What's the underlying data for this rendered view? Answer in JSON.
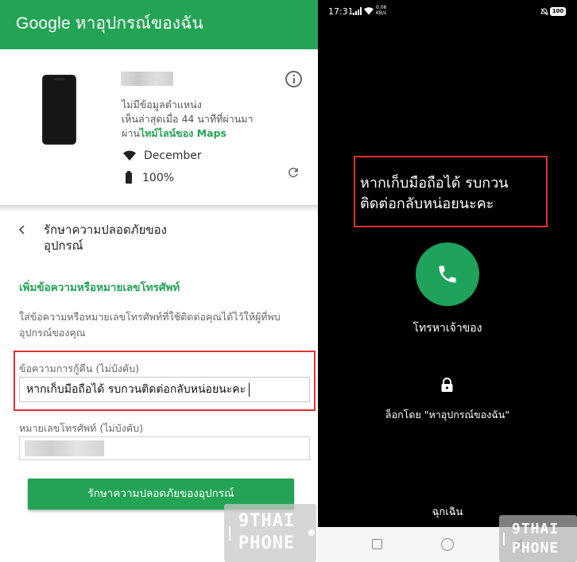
{
  "left": {
    "header": {
      "brand": "Google",
      "title": "หาอุปกรณ์ของฉัน"
    },
    "device": {
      "status_line1": "ไม่มีข้อมูลตำแหน่ง",
      "status_line2": "เห็นล่าสุดเมื่อ 44 นาทีที่ผ่านมา",
      "status_line3_prefix": "ผ่าน",
      "maps_link": "ไทม์ไลน์ของ Maps",
      "wifi": "December",
      "battery": "100%"
    },
    "secure": {
      "title": "รักษาความปลอดภัยของอุปกรณ์",
      "add_heading": "เพิ่มข้อความหรือหมายเลขโทรศัพท์",
      "description": "ใส่ข้อความหรือหมายเลขโทรศัพท์ที่ใช้ติดต่อคุณได้ไว้ให้ผู้ที่พบอุปกรณ์ของคุณ",
      "message_label": "ข้อความการกู้คืน (ไม่บังคับ)",
      "message_value": "หากเก็บมือถือได้ รบกวนติดต่อกลับหน่อยนะคะ",
      "phone_label": "หมายเลขโทรศัพท์ (ไม่บังคับ)",
      "button": "รักษาความปลอดภัยของอุปกรณ์"
    },
    "watermark": {
      "line1": "9THAI",
      "line2": "PHONE"
    }
  },
  "right": {
    "statusbar": {
      "time": "17:31",
      "speed_top": "0.06",
      "speed_bottom": "KB/s",
      "battery": "100"
    },
    "lock_message": "หากเก็บมือถือได้ รบกวน ติดต่อกลับหน่อยนะคะ",
    "call_label": "โทรหาเจ้าของ",
    "locked_by": "ล็อกโดย \"หาอุปกรณ์ของฉัน\"",
    "emergency": "ฉุกเฉิน",
    "watermark": {
      "line1": "9THAI",
      "line2": "PHONE"
    }
  },
  "icons": {
    "info": "info-icon",
    "refresh": "refresh-icon",
    "wifi": "wifi-icon",
    "battery": "battery-icon",
    "back": "chevron-left-icon",
    "call": "phone-icon",
    "lock": "lock-icon"
  },
  "colors": {
    "accent": "#23a455",
    "highlight": "#e03030",
    "call_button": "#1fa35a"
  }
}
